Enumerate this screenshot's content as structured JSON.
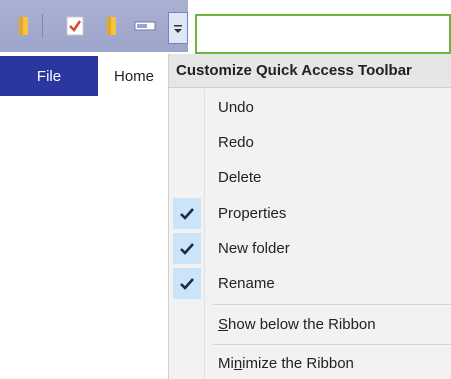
{
  "colors": {
    "file_tab_bg": "#2b36a0",
    "check_bg": "#cce4f7",
    "address_border": "#6db33f",
    "qat_bg": "#9ea5cb"
  },
  "qat": {
    "icons": [
      "folder-icon",
      "properties-check-icon",
      "new-folder-icon",
      "rename-icon",
      "customize-dropdown-icon"
    ]
  },
  "ribbon": {
    "tabs": [
      {
        "label": "File"
      },
      {
        "label": "Home"
      }
    ]
  },
  "menu": {
    "title": "Customize Quick Access Toolbar",
    "items": [
      {
        "label": "Undo",
        "checked": false
      },
      {
        "label": "Redo",
        "checked": false
      },
      {
        "label": "Delete",
        "checked": false
      },
      {
        "label": "Properties",
        "checked": true
      },
      {
        "label": "New folder",
        "checked": true
      },
      {
        "label": "Rename",
        "checked": true
      }
    ],
    "show_below": {
      "before": "",
      "accel": "S",
      "after": "how below the Ribbon"
    },
    "minimize": {
      "before": "Mi",
      "accel": "n",
      "after": "imize the Ribbon"
    }
  }
}
